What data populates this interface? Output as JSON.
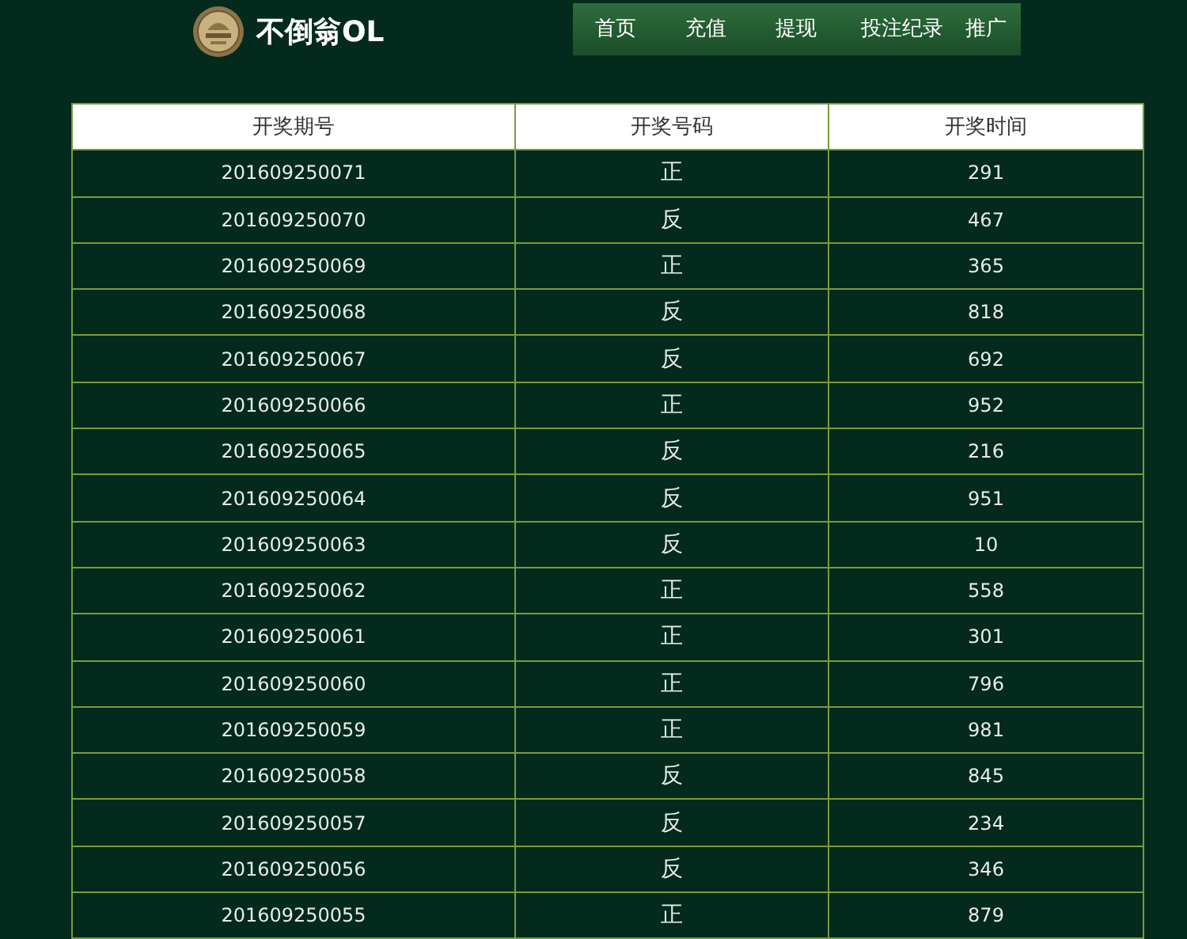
{
  "site": {
    "title": "不倒翁OL"
  },
  "nav": [
    {
      "label": "首页"
    },
    {
      "label": "充值"
    },
    {
      "label": "提现"
    },
    {
      "label": "投注纪录"
    },
    {
      "label": "推广"
    }
  ],
  "table": {
    "columns": [
      "开奖期号",
      "开奖号码",
      "开奖时间"
    ],
    "rows": [
      [
        "201609250071",
        "正",
        "291"
      ],
      [
        "201609250070",
        "反",
        "467"
      ],
      [
        "201609250069",
        "正",
        "365"
      ],
      [
        "201609250068",
        "反",
        "818"
      ],
      [
        "201609250067",
        "反",
        "692"
      ],
      [
        "201609250066",
        "正",
        "952"
      ],
      [
        "201609250065",
        "反",
        "216"
      ],
      [
        "201609250064",
        "反",
        "951"
      ],
      [
        "201609250063",
        "反",
        "10"
      ],
      [
        "201609250062",
        "正",
        "558"
      ],
      [
        "201609250061",
        "正",
        "301"
      ],
      [
        "201609250060",
        "正",
        "796"
      ],
      [
        "201609250059",
        "正",
        "981"
      ],
      [
        "201609250058",
        "反",
        "845"
      ],
      [
        "201609250057",
        "反",
        "234"
      ],
      [
        "201609250056",
        "反",
        "346"
      ],
      [
        "201609250055",
        "正",
        "879"
      ]
    ]
  }
}
